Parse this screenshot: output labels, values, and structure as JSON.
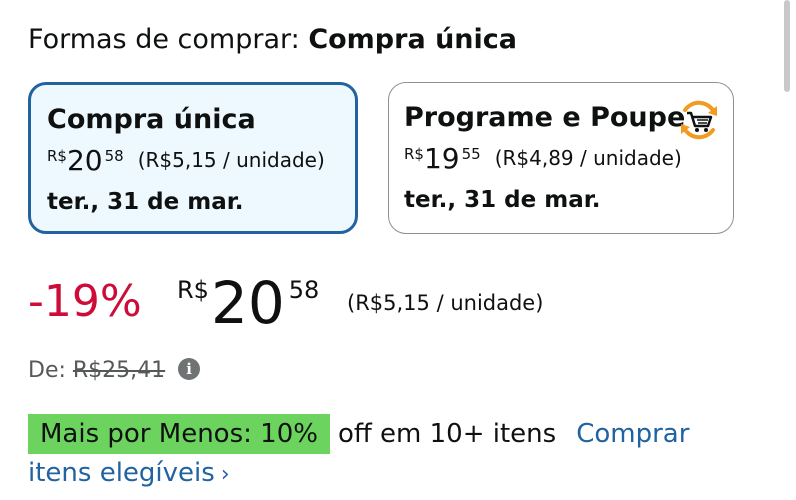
{
  "header": {
    "label": "Formas de comprar:",
    "selected": "Compra única"
  },
  "options": [
    {
      "title": "Compra única",
      "price_symbol": "R$",
      "price_whole": "20",
      "price_fraction": "58",
      "unit_price": "(R$5,15 / unidade)",
      "delivery": "ter., 31 de mar.",
      "selected": true
    },
    {
      "title": "Programe e Poupe",
      "icon": "subscribe-save-cart-icon",
      "price_symbol": "R$",
      "price_whole": "19",
      "price_fraction": "55",
      "unit_price": "(R$4,89 / unidade)",
      "delivery": "ter., 31 de mar.",
      "selected": false
    }
  ],
  "price": {
    "discount": "-19%",
    "symbol": "R$",
    "whole": "20",
    "fraction": "58",
    "unit_price": "(R$5,15 / unidade)"
  },
  "list_price": {
    "label": "De:",
    "value": "R$25,41",
    "info_icon": "info-icon",
    "info_glyph": "i"
  },
  "promo": {
    "badge": "Mais por Menos: 10%",
    "text": "off em 10+ itens",
    "link_part1": "Comprar",
    "link_part2": "itens elegíveis",
    "chevron": "›"
  },
  "colors": {
    "selected_border": "#2162a1",
    "selected_bg": "#edf8ff",
    "discount": "#cc0c39",
    "badge_bg": "#6bd35e",
    "link": "#2162a1",
    "icon_orange": "#f29b20"
  }
}
